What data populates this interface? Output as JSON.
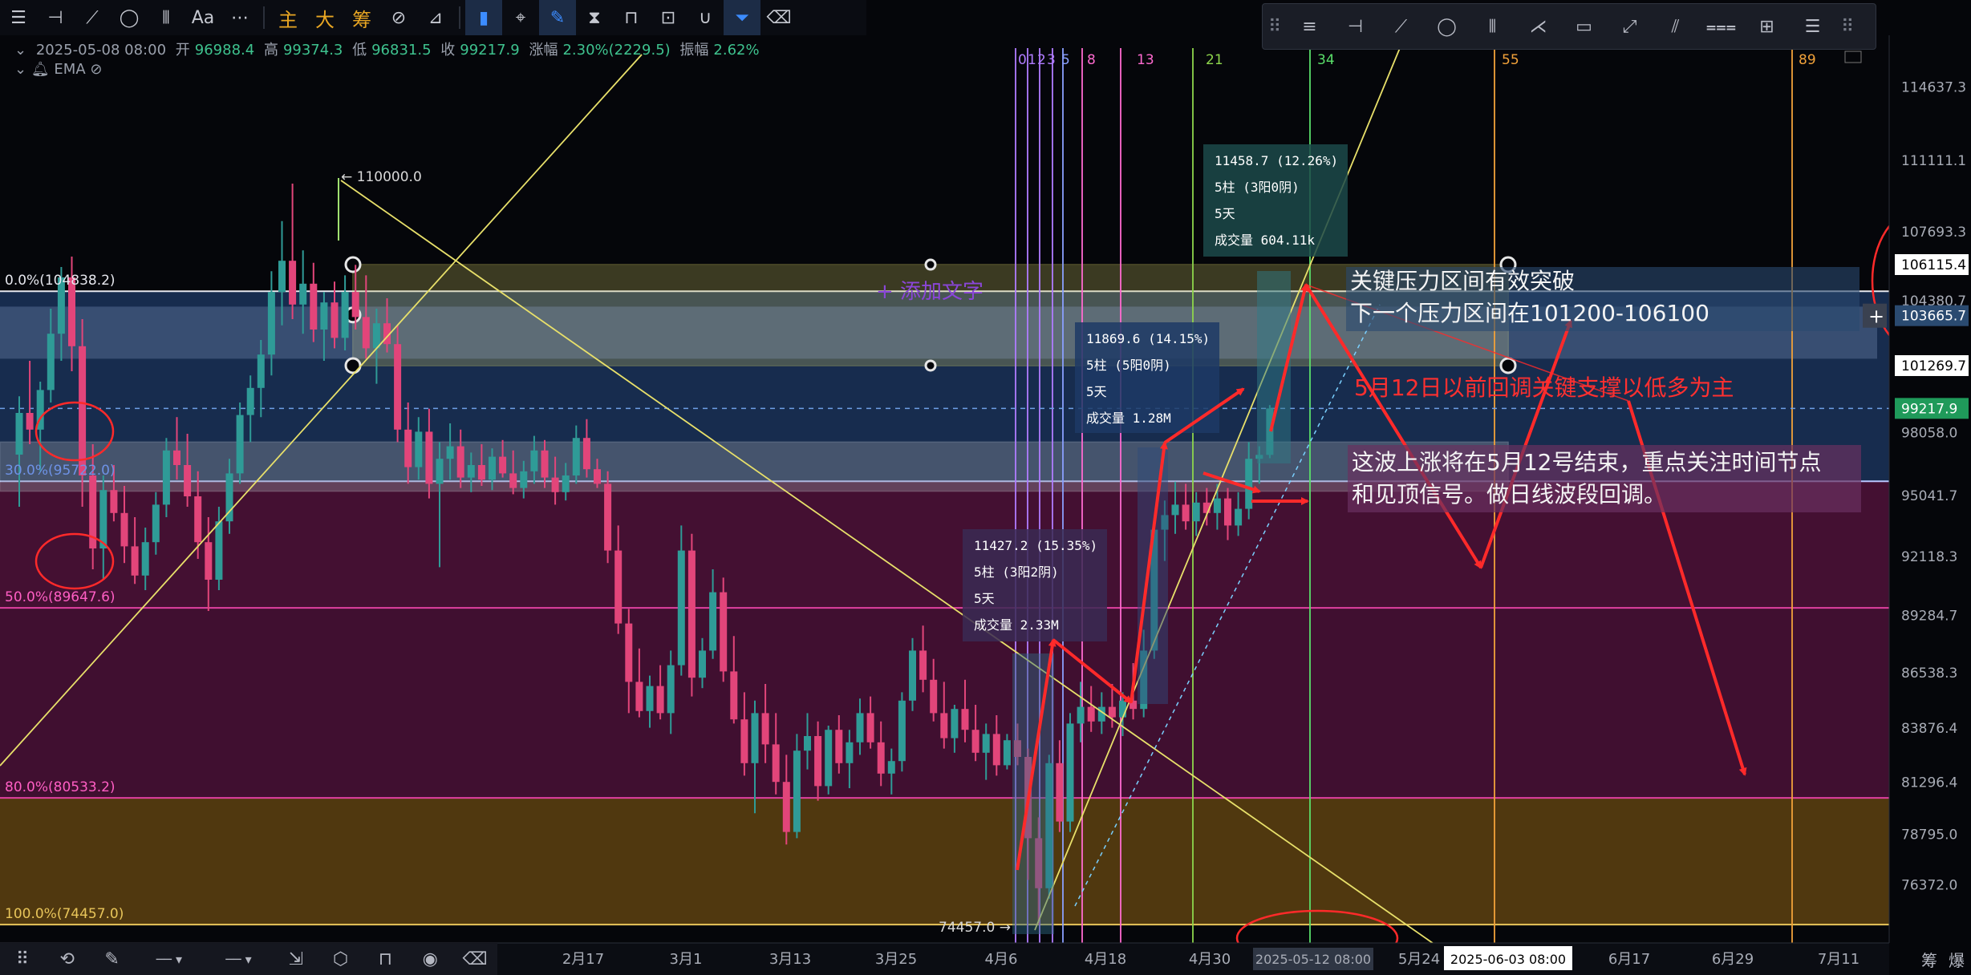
{
  "toolbar": {
    "tools": [
      {
        "name": "menu-icon",
        "glyph": "☰"
      },
      {
        "name": "horizontal-line-icon",
        "glyph": "⊣"
      },
      {
        "name": "trend-line-icon",
        "glyph": "⟋"
      },
      {
        "name": "ellipse-icon",
        "glyph": "◯"
      },
      {
        "name": "bars-icon",
        "glyph": "⦀"
      },
      {
        "name": "text-icon",
        "glyph": "Aa"
      },
      {
        "name": "more-icon",
        "glyph": "⋯"
      }
    ],
    "text_tools": [
      "主",
      "大",
      "筹"
    ],
    "tools2": [
      {
        "name": "rotate-box-icon",
        "glyph": "⊘"
      },
      {
        "name": "pen-slash-icon",
        "glyph": "⊿"
      },
      {
        "name": "bookmark-icon",
        "glyph": "▮",
        "active": true
      },
      {
        "name": "ruler-icon",
        "glyph": "⌖"
      },
      {
        "name": "pen-icon",
        "glyph": "✎",
        "active": true
      },
      {
        "name": "candles-icon",
        "glyph": "⧗"
      },
      {
        "name": "lock-icon",
        "glyph": "⊓"
      },
      {
        "name": "edit-box-icon",
        "glyph": "⊡"
      },
      {
        "name": "magnet-icon",
        "glyph": "∪"
      },
      {
        "name": "filter-icon",
        "glyph": "⏷",
        "active": true
      },
      {
        "name": "trash-icon",
        "glyph": "⌫"
      }
    ]
  },
  "float_toolbar": {
    "tools": [
      "⠿",
      "≡",
      "⊣",
      "⟋",
      "◯",
      "⦀",
      "⋌",
      "▭",
      "⤢",
      "⫽",
      "⩶",
      "⊞",
      "☰",
      "⠿"
    ]
  },
  "info": {
    "datetime": "2025-05-08 08:00",
    "open_label": "开",
    "open": "96988.4",
    "high_label": "高",
    "high": "99374.3",
    "low_label": "低",
    "low": "96831.5",
    "close_label": "收",
    "close": "99217.9",
    "change_label": "涨幅",
    "change": "2.30%(2229.5)",
    "amp_label": "振幅",
    "amp": "2.62%",
    "ema": "EMA"
  },
  "bottom_bar": {
    "tools": [
      "⠿",
      "⟲",
      "✎",
      "── ▾",
      "── ▾",
      "⇲",
      "⬡",
      "⊓",
      "◉",
      "⌫"
    ],
    "corner": [
      "筹",
      "爆"
    ]
  },
  "chart_data": {
    "type": "candlestick",
    "colors": {
      "up": "#2f9b97",
      "down": "#e2457a",
      "fib_line": "#9fb8e8",
      "fib_pink": "#e040a0",
      "annotation": "#ff2a2a",
      "yellow": "#e8e06a"
    },
    "y_range": [
      73500,
      116500
    ],
    "price_ticks": [
      "114637.3",
      "111111.1",
      "107693.3",
      "104380.7",
      "101269.7",
      "98058.0",
      "95041.7",
      "92118.3",
      "89284.7",
      "86538.3",
      "83876.4",
      "81296.4",
      "78795.0",
      "76372.0"
    ],
    "right_tags": {
      "top": "106115.4",
      "mid": "103665.7",
      "low": "101269.7",
      "current": "99217.9"
    },
    "x_labels": [
      "2月17",
      "3月1",
      "3月13",
      "3月25",
      "4月6",
      "4月18",
      "4月30",
      "2025-05-12 08:00",
      "5月24",
      "2025-06-03 08:00",
      "6月17",
      "6月29",
      "7月11"
    ],
    "fib_levels": [
      {
        "label": "0.0%(104838.2)",
        "price": 104838.2
      },
      {
        "label": "30.0%(95722.0)",
        "price": 95722.0
      },
      {
        "label": "50.0%(89647.6)",
        "price": 89647.6
      },
      {
        "label": "80.0%(80533.2)",
        "price": 80533.2
      },
      {
        "label": "100.0%(74457.0)",
        "price": 74457.0
      }
    ],
    "fib_numbers": [
      "0",
      "1",
      "2",
      "3",
      "5",
      "8",
      "13",
      "21",
      "34",
      "55",
      "89"
    ],
    "price_marks": {
      "high": "110000.0",
      "low": "74457.0"
    },
    "measure_boxes": [
      {
        "lines": [
          "11458.7 (12.26%)",
          "5柱 (3阳0阴)",
          "5天",
          "成交量 604.11k"
        ]
      },
      {
        "lines": [
          "11869.6 (14.15%)",
          "5柱 (5阳0阴)",
          "5天",
          "成交量 1.28M"
        ]
      },
      {
        "lines": [
          "11427.2 (15.35%)",
          "5柱 (3阳2阴)",
          "5天",
          "成交量 2.33M"
        ]
      }
    ],
    "add_text_label": "+ 添加文字",
    "annotations": {
      "resist_1": "关键压力区间有效突破",
      "resist_2": "下一个压力区间在101200-106100",
      "support": "5月12日以前回调关键支撑以低多为主",
      "time_1": "这波上涨将在5月12号结束，重点关注时间节点",
      "time_2": "和见顶信号。做日线波段回调。"
    },
    "candles": [
      {
        "o": 97000,
        "h": 99800,
        "l": 94500,
        "c": 99000
      },
      {
        "o": 99000,
        "h": 101500,
        "l": 97500,
        "c": 98200
      },
      {
        "o": 98200,
        "h": 100500,
        "l": 96200,
        "c": 100100
      },
      {
        "o": 100100,
        "h": 104000,
        "l": 99500,
        "c": 102800
      },
      {
        "o": 102800,
        "h": 106000,
        "l": 101500,
        "c": 105500
      },
      {
        "o": 105500,
        "h": 106500,
        "l": 101000,
        "c": 102200
      },
      {
        "o": 102200,
        "h": 103500,
        "l": 94500,
        "c": 96000
      },
      {
        "o": 96000,
        "h": 97500,
        "l": 91500,
        "c": 92500
      },
      {
        "o": 92500,
        "h": 96000,
        "l": 91000,
        "c": 95300
      },
      {
        "o": 95300,
        "h": 96500,
        "l": 93800,
        "c": 94200
      },
      {
        "o": 94200,
        "h": 95500,
        "l": 91800,
        "c": 92600
      },
      {
        "o": 92600,
        "h": 94000,
        "l": 90800,
        "c": 91200
      },
      {
        "o": 91200,
        "h": 93500,
        "l": 90500,
        "c": 92800
      },
      {
        "o": 92800,
        "h": 95200,
        "l": 92200,
        "c": 94600
      },
      {
        "o": 94600,
        "h": 97800,
        "l": 94000,
        "c": 97200
      },
      {
        "o": 97200,
        "h": 98800,
        "l": 95800,
        "c": 96500
      },
      {
        "o": 96500,
        "h": 98000,
        "l": 94500,
        "c": 95000
      },
      {
        "o": 95000,
        "h": 96200,
        "l": 92000,
        "c": 92800
      },
      {
        "o": 92800,
        "h": 94000,
        "l": 89500,
        "c": 91000
      },
      {
        "o": 91000,
        "h": 94500,
        "l": 90500,
        "c": 93800
      },
      {
        "o": 93800,
        "h": 96800,
        "l": 93200,
        "c": 96100
      },
      {
        "o": 96100,
        "h": 99500,
        "l": 95600,
        "c": 98900
      },
      {
        "o": 98900,
        "h": 100800,
        "l": 97600,
        "c": 100200
      },
      {
        "o": 100200,
        "h": 102500,
        "l": 98800,
        "c": 101800
      },
      {
        "o": 101800,
        "h": 105800,
        "l": 100800,
        "c": 104800
      },
      {
        "o": 104800,
        "h": 108200,
        "l": 103200,
        "c": 106300
      },
      {
        "o": 106300,
        "h": 110000,
        "l": 103500,
        "c": 104200
      },
      {
        "o": 104200,
        "h": 106800,
        "l": 102800,
        "c": 105200
      },
      {
        "o": 105200,
        "h": 106200,
        "l": 102400,
        "c": 103000
      },
      {
        "o": 103000,
        "h": 104800,
        "l": 101500,
        "c": 104300
      },
      {
        "o": 104300,
        "h": 105300,
        "l": 102100,
        "c": 102600
      },
      {
        "o": 102600,
        "h": 105600,
        "l": 102000,
        "c": 104800
      },
      {
        "o": 104800,
        "h": 106100,
        "l": 103000,
        "c": 103600
      },
      {
        "o": 103600,
        "h": 105600,
        "l": 101600,
        "c": 102100
      },
      {
        "o": 102100,
        "h": 104000,
        "l": 100400,
        "c": 103300
      },
      {
        "o": 103300,
        "h": 104500,
        "l": 101900,
        "c": 102300
      },
      {
        "o": 102300,
        "h": 103200,
        "l": 97600,
        "c": 98200
      },
      {
        "o": 98200,
        "h": 99500,
        "l": 95600,
        "c": 96400
      },
      {
        "o": 96400,
        "h": 98800,
        "l": 95800,
        "c": 98100
      },
      {
        "o": 98100,
        "h": 99200,
        "l": 94900,
        "c": 95600
      },
      {
        "o": 95600,
        "h": 97600,
        "l": 91600,
        "c": 96800
      },
      {
        "o": 96800,
        "h": 98500,
        "l": 95800,
        "c": 97400
      },
      {
        "o": 97400,
        "h": 98200,
        "l": 95400,
        "c": 95900
      },
      {
        "o": 95900,
        "h": 97100,
        "l": 95200,
        "c": 96500
      },
      {
        "o": 96500,
        "h": 97500,
        "l": 95500,
        "c": 95800
      },
      {
        "o": 95800,
        "h": 97300,
        "l": 95300,
        "c": 96900
      },
      {
        "o": 96900,
        "h": 97700,
        "l": 95900,
        "c": 96100
      },
      {
        "o": 96100,
        "h": 97200,
        "l": 95100,
        "c": 95400
      },
      {
        "o": 95400,
        "h": 96700,
        "l": 94900,
        "c": 96200
      },
      {
        "o": 96200,
        "h": 97900,
        "l": 95600,
        "c": 97200
      },
      {
        "o": 97200,
        "h": 97700,
        "l": 95400,
        "c": 95900
      },
      {
        "o": 95900,
        "h": 96900,
        "l": 94600,
        "c": 95200
      },
      {
        "o": 95200,
        "h": 96600,
        "l": 94800,
        "c": 96000
      },
      {
        "o": 96000,
        "h": 98400,
        "l": 95600,
        "c": 97800
      },
      {
        "o": 97800,
        "h": 98700,
        "l": 95900,
        "c": 96300
      },
      {
        "o": 96300,
        "h": 96800,
        "l": 95400,
        "c": 95600
      },
      {
        "o": 95600,
        "h": 96200,
        "l": 91800,
        "c": 92400
      },
      {
        "o": 92400,
        "h": 93600,
        "l": 88400,
        "c": 88900
      },
      {
        "o": 88900,
        "h": 89600,
        "l": 84600,
        "c": 86100
      },
      {
        "o": 86100,
        "h": 87700,
        "l": 84400,
        "c": 84700
      },
      {
        "o": 84700,
        "h": 86400,
        "l": 83900,
        "c": 85900
      },
      {
        "o": 85900,
        "h": 86900,
        "l": 84300,
        "c": 84600
      },
      {
        "o": 84600,
        "h": 87600,
        "l": 83600,
        "c": 86900
      },
      {
        "o": 86900,
        "h": 93600,
        "l": 86400,
        "c": 92400
      },
      {
        "o": 92400,
        "h": 93200,
        "l": 85400,
        "c": 86300
      },
      {
        "o": 86300,
        "h": 88200,
        "l": 85800,
        "c": 87600
      },
      {
        "o": 87600,
        "h": 91500,
        "l": 87200,
        "c": 90400
      },
      {
        "o": 90400,
        "h": 91100,
        "l": 86100,
        "c": 86600
      },
      {
        "o": 86600,
        "h": 88300,
        "l": 84100,
        "c": 84300
      },
      {
        "o": 84300,
        "h": 85600,
        "l": 81600,
        "c": 82200
      },
      {
        "o": 82200,
        "h": 85200,
        "l": 79800,
        "c": 84600
      },
      {
        "o": 84600,
        "h": 86000,
        "l": 82200,
        "c": 83100
      },
      {
        "o": 83100,
        "h": 84600,
        "l": 80700,
        "c": 81300
      },
      {
        "o": 81300,
        "h": 82600,
        "l": 78300,
        "c": 78900
      },
      {
        "o": 78900,
        "h": 83600,
        "l": 78600,
        "c": 82800
      },
      {
        "o": 82800,
        "h": 84600,
        "l": 81900,
        "c": 83500
      },
      {
        "o": 83500,
        "h": 84200,
        "l": 80400,
        "c": 81100
      },
      {
        "o": 81100,
        "h": 84000,
        "l": 80700,
        "c": 83800
      },
      {
        "o": 83800,
        "h": 84500,
        "l": 81700,
        "c": 82200
      },
      {
        "o": 82200,
        "h": 83800,
        "l": 81000,
        "c": 83200
      },
      {
        "o": 83200,
        "h": 85300,
        "l": 82600,
        "c": 84600
      },
      {
        "o": 84600,
        "h": 85400,
        "l": 82900,
        "c": 83200
      },
      {
        "o": 83200,
        "h": 84200,
        "l": 81100,
        "c": 81700
      },
      {
        "o": 81700,
        "h": 82900,
        "l": 80700,
        "c": 82300
      },
      {
        "o": 82300,
        "h": 85600,
        "l": 81800,
        "c": 85200
      },
      {
        "o": 85200,
        "h": 88200,
        "l": 84700,
        "c": 87600
      },
      {
        "o": 87600,
        "h": 88800,
        "l": 85600,
        "c": 86200
      },
      {
        "o": 86200,
        "h": 87200,
        "l": 84200,
        "c": 84600
      },
      {
        "o": 84600,
        "h": 86100,
        "l": 82900,
        "c": 83400
      },
      {
        "o": 83400,
        "h": 85000,
        "l": 82700,
        "c": 84800
      },
      {
        "o": 84800,
        "h": 86200,
        "l": 83200,
        "c": 83800
      },
      {
        "o": 83800,
        "h": 85000,
        "l": 82300,
        "c": 82700
      },
      {
        "o": 82700,
        "h": 84100,
        "l": 81400,
        "c": 83600
      },
      {
        "o": 83600,
        "h": 84500,
        "l": 81600,
        "c": 82100
      },
      {
        "o": 82100,
        "h": 83600,
        "l": 81900,
        "c": 83300
      },
      {
        "o": 83300,
        "h": 84100,
        "l": 82100,
        "c": 82500
      },
      {
        "o": 82500,
        "h": 82900,
        "l": 76600,
        "c": 78600
      },
      {
        "o": 78600,
        "h": 79600,
        "l": 74457,
        "c": 76200
      },
      {
        "o": 76200,
        "h": 82600,
        "l": 75700,
        "c": 82200
      },
      {
        "o": 82200,
        "h": 83300,
        "l": 78900,
        "c": 79400
      },
      {
        "o": 79400,
        "h": 84600,
        "l": 78900,
        "c": 84100
      },
      {
        "o": 84100,
        "h": 86100,
        "l": 83200,
        "c": 84900
      },
      {
        "o": 84900,
        "h": 85900,
        "l": 83700,
        "c": 84200
      },
      {
        "o": 84200,
        "h": 85600,
        "l": 83600,
        "c": 84900
      },
      {
        "o": 84900,
        "h": 86000,
        "l": 83900,
        "c": 84400
      },
      {
        "o": 84400,
        "h": 85600,
        "l": 83500,
        "c": 85200
      },
      {
        "o": 85200,
        "h": 87000,
        "l": 84300,
        "c": 84800
      },
      {
        "o": 84800,
        "h": 88600,
        "l": 84400,
        "c": 87600
      },
      {
        "o": 87600,
        "h": 93800,
        "l": 87200,
        "c": 93400
      },
      {
        "o": 93400,
        "h": 94800,
        "l": 91900,
        "c": 94100
      },
      {
        "o": 94100,
        "h": 95700,
        "l": 93200,
        "c": 94600
      },
      {
        "o": 94600,
        "h": 95600,
        "l": 93400,
        "c": 93800
      },
      {
        "o": 93800,
        "h": 95200,
        "l": 93100,
        "c": 94700
      },
      {
        "o": 94700,
        "h": 95400,
        "l": 93600,
        "c": 94200
      },
      {
        "o": 94200,
        "h": 95600,
        "l": 93400,
        "c": 94900
      },
      {
        "o": 94900,
        "h": 95400,
        "l": 92900,
        "c": 93600
      },
      {
        "o": 93600,
        "h": 95200,
        "l": 93100,
        "c": 94400
      },
      {
        "o": 94400,
        "h": 97600,
        "l": 93900,
        "c": 96800
      },
      {
        "o": 96800,
        "h": 97400,
        "l": 95600,
        "c": 96988
      },
      {
        "o": 96988,
        "h": 99374,
        "l": 96831,
        "c": 99217
      }
    ]
  }
}
